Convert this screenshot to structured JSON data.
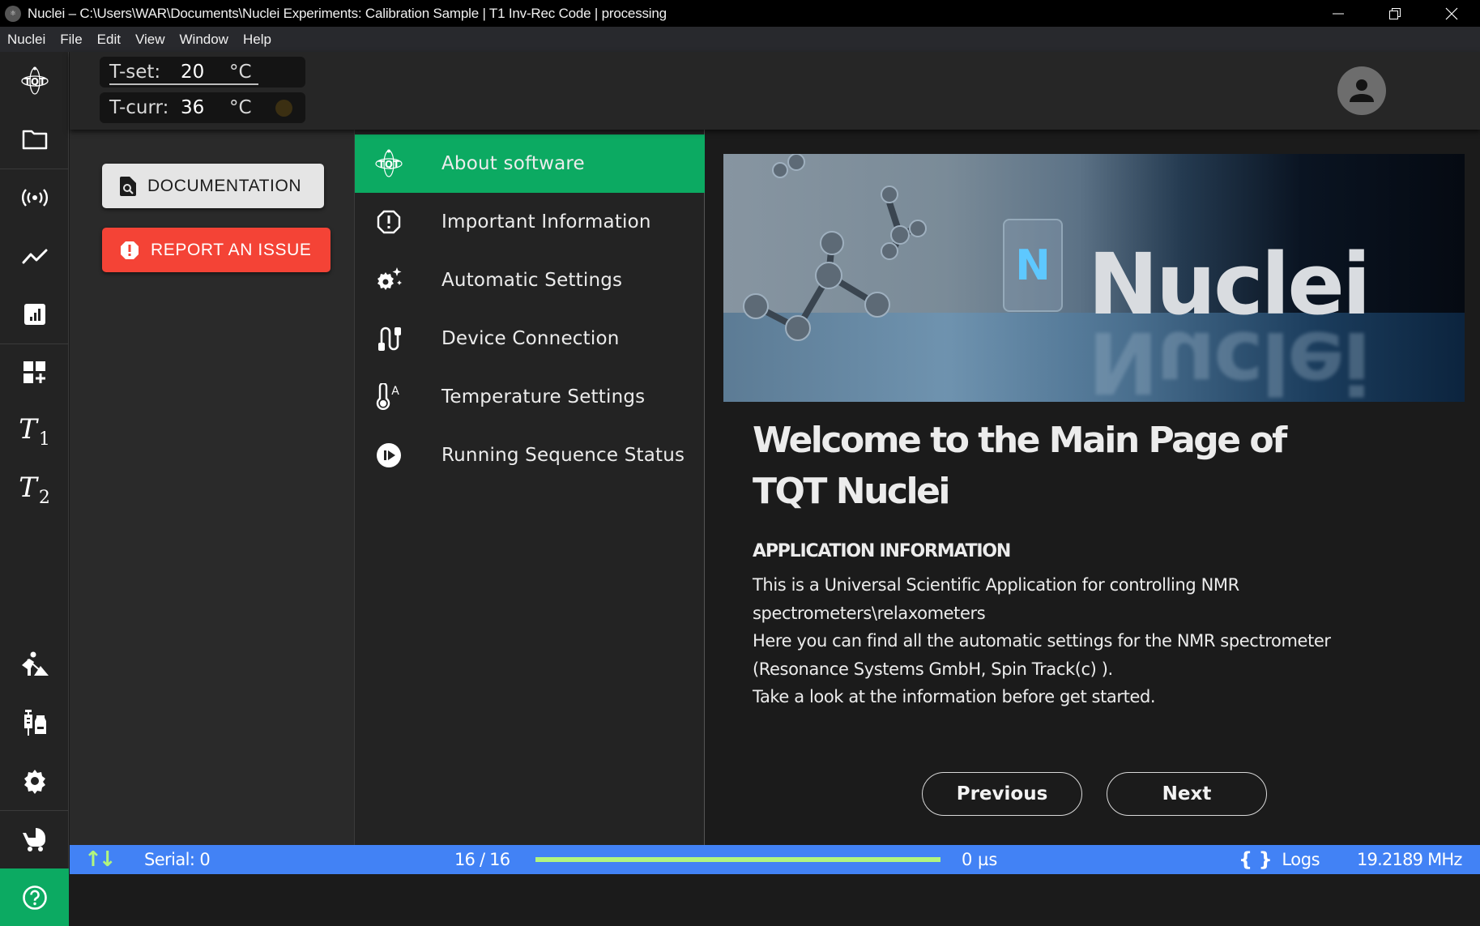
{
  "window": {
    "title": "Nuclei – C:\\Users\\WAR\\Documents\\Nuclei Experiments: Calibration Sample | T1 Inv-Rec Code | processing",
    "controls": {
      "minimize": "—",
      "restore": "❐",
      "close": "✕"
    }
  },
  "menubar": {
    "items": [
      "Nuclei",
      "File",
      "Edit",
      "View",
      "Window",
      "Help"
    ]
  },
  "sidebar": {
    "items": [
      {
        "icon": "tqt-logo-icon"
      },
      {
        "icon": "folder-icon"
      },
      {
        "icon": "broadcast-icon"
      },
      {
        "icon": "line-chart-icon"
      },
      {
        "icon": "bar-chart-icon"
      },
      {
        "icon": "dashboard-add-icon"
      },
      {
        "icon": "t1-icon",
        "label": "T",
        "sub": "1"
      },
      {
        "icon": "t2-icon",
        "label": "T",
        "sub": "2"
      },
      {
        "icon": "construction-worker-icon"
      },
      {
        "icon": "vaccine-icon"
      },
      {
        "icon": "gear-icon"
      },
      {
        "icon": "stroller-icon"
      },
      {
        "icon": "help-icon"
      }
    ]
  },
  "header": {
    "t_set": {
      "label": "T-set:",
      "value": "20",
      "unit": "°C"
    },
    "t_curr": {
      "label": "T-curr:",
      "value": "36",
      "unit": "°C",
      "indicator_color": "#3b2f12"
    }
  },
  "left_panel": {
    "documentation_label": "DOCUMENTATION",
    "report_label": "REPORT AN ISSUE"
  },
  "menu": {
    "items": [
      {
        "label": "About software",
        "icon": "tqt-logo-icon",
        "active": true
      },
      {
        "label": "Important Information",
        "icon": "alert-octagon-icon",
        "active": false
      },
      {
        "label": "Automatic Settings",
        "icon": "auto-gear-icon",
        "active": false
      },
      {
        "label": "Device Connection",
        "icon": "cable-icon",
        "active": false
      },
      {
        "label": "Temperature Settings",
        "icon": "thermometer-auto-icon",
        "active": false
      },
      {
        "label": "Running Sequence Status",
        "icon": "play-pause-circle-icon",
        "active": false
      }
    ]
  },
  "content": {
    "banner": {
      "word": "Nuclei",
      "tile_letter": "N"
    },
    "title": "Welcome to the Main Page of TQT Nuclei",
    "section_heading": "APPLICATION INFORMATION",
    "paragraphs": [
      "This is a Universal Scientific Application for controlling NMR spectrometers\\relaxometers",
      "Here you can find all the automatic settings for the NMR spectrometer (Resonance Systems GmbH, Spin Track(c) ).",
      "Take a look at the information before get started."
    ],
    "previous_label": "Previous",
    "next_label": "Next"
  },
  "statusbar": {
    "arrows": "↑↓",
    "serial": "Serial: 0",
    "count": "16 / 16",
    "progress": 1.0,
    "time": "0 µs",
    "logs_icon": "{ }",
    "logs_label": "Logs",
    "frequency": "19.2189 MHz",
    "colors": {
      "background": "#4282f5",
      "progress": "#b2f57e"
    }
  },
  "colors": {
    "accent": "#0caa62",
    "danger": "#f44336"
  }
}
